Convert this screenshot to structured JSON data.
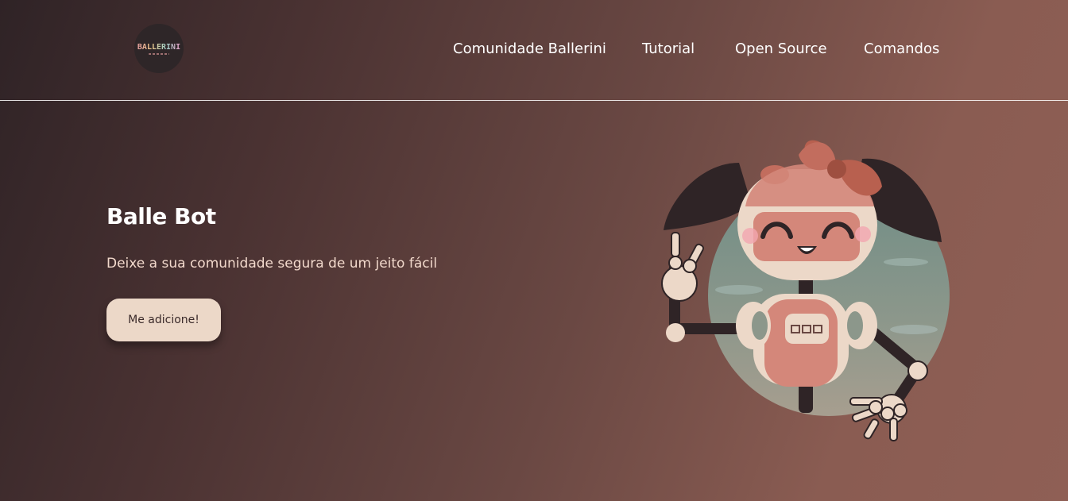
{
  "header": {
    "logo_text": "BALLERINI",
    "nav": [
      {
        "label": "Comunidade Ballerini"
      },
      {
        "label": "Tutorial"
      },
      {
        "label": "Open Source"
      },
      {
        "label": "Comandos"
      }
    ]
  },
  "hero": {
    "title": "Balle Bot",
    "subtitle": "Deixe a sua comunidade segura de um jeito fácil",
    "cta_label": "Me adicione!"
  },
  "colors": {
    "background_start": "#2f2326",
    "background_end": "#8f5f55",
    "cta_bg": "#ecd8c8",
    "robot_accent": "#d4877a"
  },
  "illustration": {
    "icon": "robot-mascot-illustration"
  }
}
